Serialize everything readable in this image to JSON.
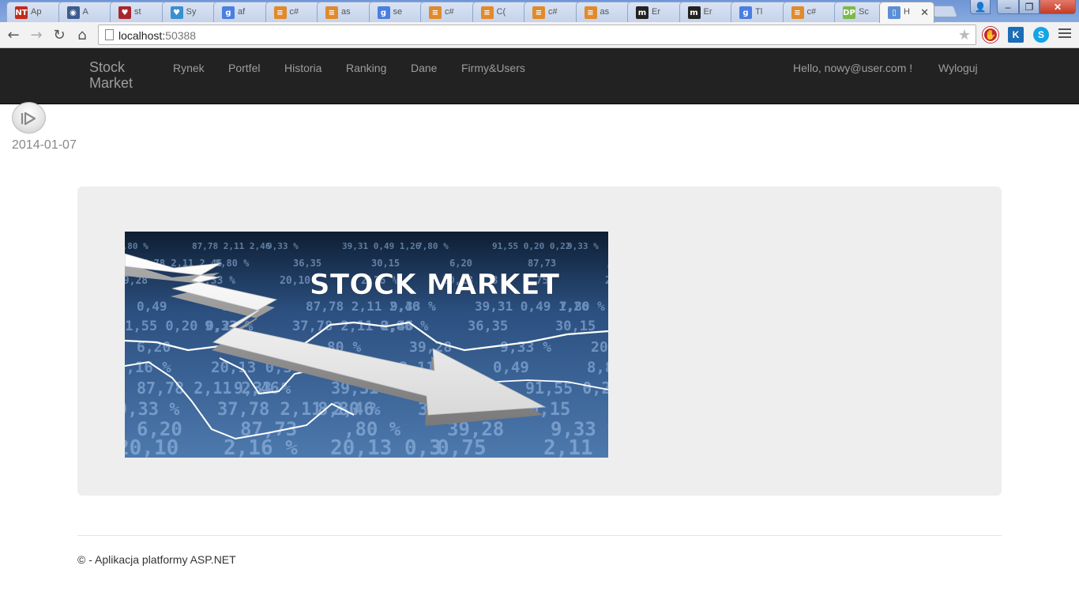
{
  "browser": {
    "tabs": [
      {
        "label": "Ap",
        "icon": "nt-icon",
        "color": "#c42b1c",
        "glyph": "NT"
      },
      {
        "label": "A",
        "icon": "shield-icon",
        "color": "#3e5b8f",
        "glyph": "◉"
      },
      {
        "label": "st",
        "icon": "heraldic-icon",
        "color": "#a8262b",
        "glyph": "♥"
      },
      {
        "label": "Sy",
        "icon": "shield-icon",
        "color": "#3a8fd1",
        "glyph": "♥"
      },
      {
        "label": "af",
        "icon": "google-icon",
        "color": "#4a7fe0",
        "glyph": "g"
      },
      {
        "label": "c#",
        "icon": "stackoverflow-icon",
        "color": "#e08a2c",
        "glyph": "≡"
      },
      {
        "label": "as",
        "icon": "stackoverflow-icon",
        "color": "#e08a2c",
        "glyph": "≡"
      },
      {
        "label": "se",
        "icon": "google-icon",
        "color": "#4a7fe0",
        "glyph": "g"
      },
      {
        "label": "c#",
        "icon": "stackoverflow-icon",
        "color": "#e08a2c",
        "glyph": "≡"
      },
      {
        "label": "C(",
        "icon": "stackoverflow-icon",
        "color": "#e08a2c",
        "glyph": "≡"
      },
      {
        "label": "c#",
        "icon": "stackoverflow-icon",
        "color": "#e08a2c",
        "glyph": "≡"
      },
      {
        "label": "as",
        "icon": "stackoverflow-icon",
        "color": "#e08a2c",
        "glyph": "≡"
      },
      {
        "label": "Er",
        "icon": "m-icon",
        "color": "#222222",
        "glyph": "m"
      },
      {
        "label": "Er",
        "icon": "m-icon",
        "color": "#222222",
        "glyph": "m"
      },
      {
        "label": "Tl",
        "icon": "google-icon",
        "color": "#4a7fe0",
        "glyph": "g"
      },
      {
        "label": "c#",
        "icon": "stackoverflow-icon",
        "color": "#e08a2c",
        "glyph": "≡"
      },
      {
        "label": "Sc",
        "icon": "dp-icon",
        "color": "#7db84a",
        "glyph": "DP"
      },
      {
        "label": "H",
        "icon": "page-icon",
        "color": "#5b8ed6",
        "glyph": "▯",
        "active": true
      }
    ],
    "url_host": "localhost:",
    "url_port": "50388"
  },
  "navbar": {
    "brand": "Stock Market",
    "links": [
      "Rynek",
      "Portfel",
      "Historia",
      "Ranking",
      "Dane",
      "Firmy&Users"
    ],
    "hello": "Hello, nowy@user.com !",
    "logout": "Wyloguj"
  },
  "date": "2014-01-07",
  "banner": {
    "title": "STOCK MARKET",
    "numbers": [
      "8,80 %",
      "87,78 2,11 2,46",
      "9,33 %",
      "39,31 0,49 1,26",
      "7,80 %",
      "91,55 0,20 0,22",
      "9,33 %",
      "37,78 2,11 2,46",
      "8,80 %",
      "36,35",
      "30,15",
      "6,20",
      "87,73",
      ",80 %",
      "39,28",
      "9,33 %",
      "20,10",
      "2,16 %",
      "20,13 0,3",
      "0,75",
      "2,11",
      "0,49"
    ]
  },
  "footer": "© - Aplikacja platformy ASP.NET",
  "colors": {
    "navbar_bg": "#222222",
    "nav_text": "#9d9d9d",
    "jumbotron_bg": "#eeeeee",
    "date_text": "#888888"
  }
}
